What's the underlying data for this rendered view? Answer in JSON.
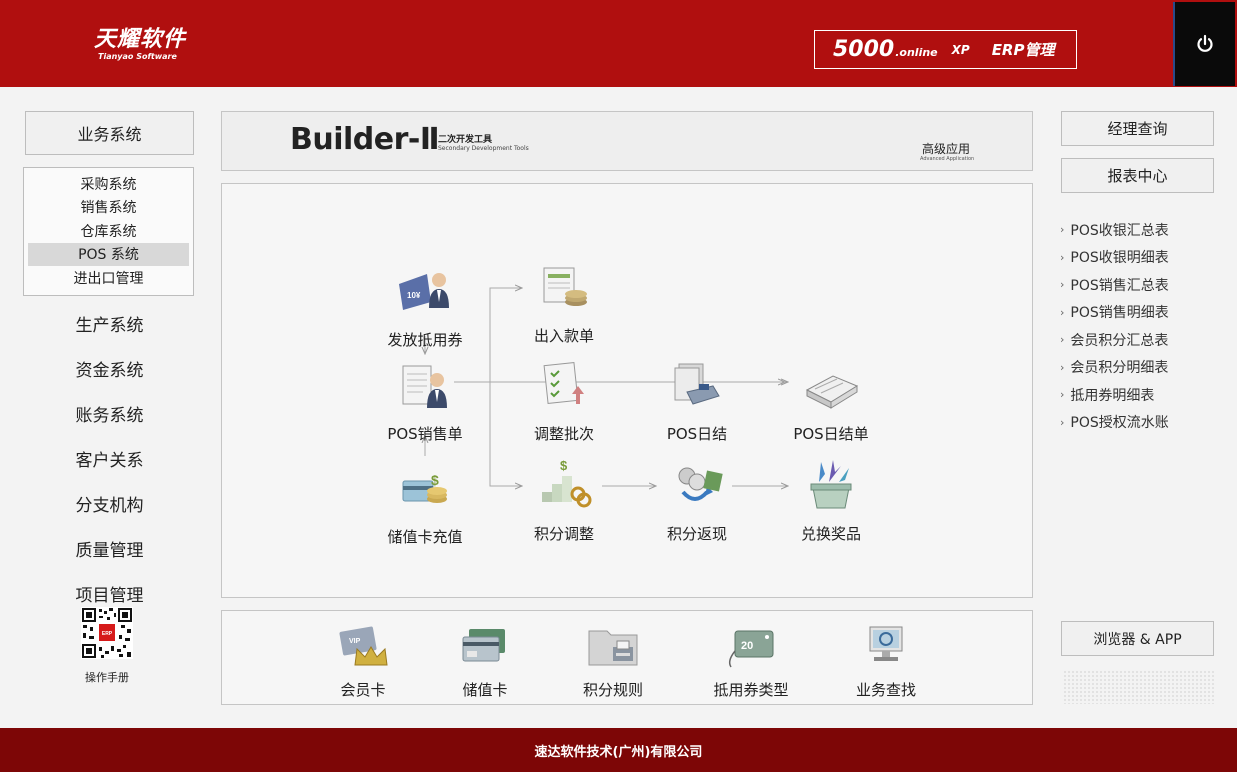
{
  "header": {
    "logo_cn": "天耀软件",
    "logo_en": "Tianyao Software",
    "erp_num": "5000",
    "erp_online": ".online",
    "erp_xp": "XP",
    "erp_name": "ERP管理",
    "power_icon": "power-icon"
  },
  "sidebar": {
    "main_button": "业务系统",
    "sub_items": [
      {
        "label": "采购系统",
        "active": false
      },
      {
        "label": "销售系统",
        "active": false
      },
      {
        "label": "仓库系统",
        "active": false
      },
      {
        "label": "POS 系统",
        "active": true
      },
      {
        "label": "进出口管理",
        "active": false
      }
    ],
    "items": [
      "生产系统",
      "资金系统",
      "账务系统",
      "客户关系",
      "分支机构",
      "质量管理",
      "项目管理"
    ],
    "manual_label": "操作手册"
  },
  "banner": {
    "title": "Builder-Ⅱ",
    "sub_cn": "二次开发工具",
    "sub_en": "Secondary Development Tools",
    "adv_cn": "高级应用",
    "adv_en": "Advanced Application"
  },
  "flow": {
    "nodes": [
      {
        "label": "发放抵用券",
        "icon": "coupon-issue-icon"
      },
      {
        "label": "POS销售单",
        "icon": "pos-sales-icon"
      },
      {
        "label": "储值卡充值",
        "icon": "card-recharge-icon"
      },
      {
        "label": "出入款单",
        "icon": "cash-voucher-icon"
      },
      {
        "label": "调整批次",
        "icon": "batch-adjust-icon"
      },
      {
        "label": "积分调整",
        "icon": "points-adjust-icon"
      },
      {
        "label": "POS日结",
        "icon": "daily-close-icon"
      },
      {
        "label": "积分返现",
        "icon": "points-cashback-icon"
      },
      {
        "label": "POS日结单",
        "icon": "daily-report-icon"
      },
      {
        "label": "兑换奖品",
        "icon": "prize-exchange-icon"
      }
    ]
  },
  "tools": [
    {
      "label": "会员卡",
      "icon": "member-card-icon"
    },
    {
      "label": "储值卡",
      "icon": "stored-card-icon"
    },
    {
      "label": "积分规则",
      "icon": "points-rule-icon"
    },
    {
      "label": "抵用券类型",
      "icon": "coupon-type-icon"
    },
    {
      "label": "业务查找",
      "icon": "business-search-icon"
    }
  ],
  "right": {
    "btn_manager": "经理查询",
    "btn_reports": "报表中心",
    "reports": [
      "POS收银汇总表",
      "POS收银明细表",
      "POS销售汇总表",
      "POS销售明细表",
      "会员积分汇总表",
      "会员积分明细表",
      "抵用券明细表",
      "POS授权流水账"
    ],
    "btn_browser": "浏览器 & APP"
  },
  "footer": {
    "company": "速达软件技术(广州)有限公司"
  }
}
